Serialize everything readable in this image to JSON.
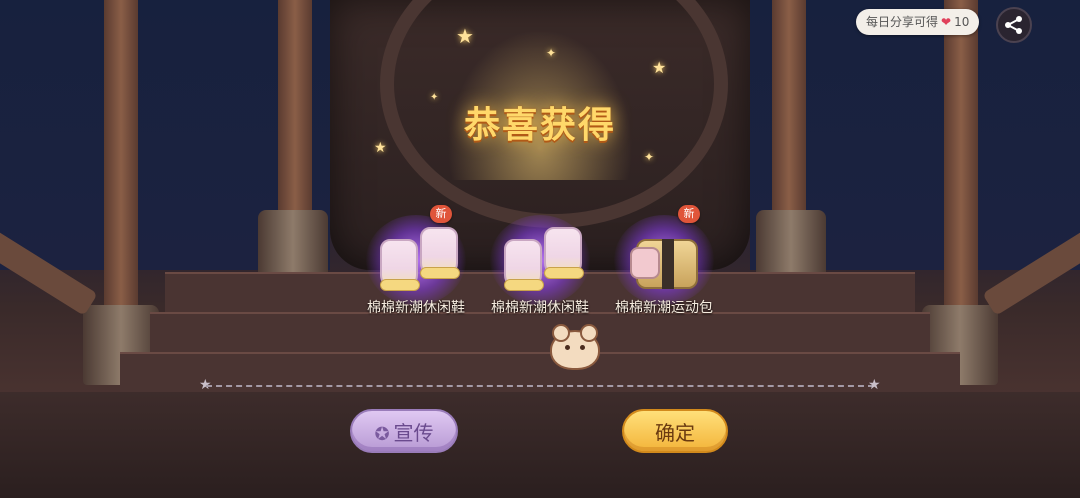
{
  "title": "恭喜获得",
  "rewards": [
    {
      "name": "棉棉新潮休闲鞋",
      "is_new": true,
      "new_label": "新",
      "icon": "shoe-icon"
    },
    {
      "name": "棉棉新潮休闲鞋",
      "is_new": false,
      "new_label": "新",
      "icon": "shoe-icon"
    },
    {
      "name": "棉棉新潮运动包",
      "is_new": true,
      "new_label": "新",
      "icon": "bag-icon"
    }
  ],
  "buttons": {
    "share_label": "宣传",
    "confirm_label": "确定"
  },
  "share_bonus": {
    "text": "每日分享可得",
    "count": "10",
    "icon": "heart-icon"
  },
  "colors": {
    "title": "#ffd86a",
    "share_button": "#c9aee4",
    "confirm_button": "#f7c94f",
    "glow": "#9b55e6"
  }
}
